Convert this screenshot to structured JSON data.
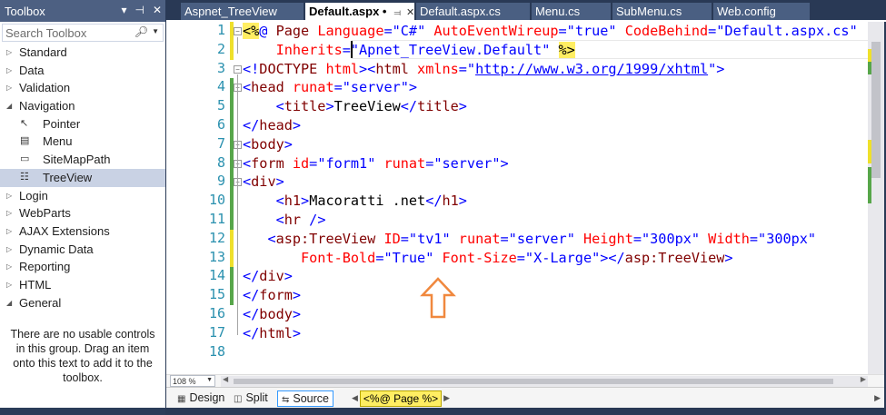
{
  "toolbox": {
    "title": "Toolbox",
    "dropdown_glyph": "▾",
    "pin_glyph": "⊣",
    "close_glyph": "✕",
    "search_placeholder": "Search Toolbox",
    "categories_before": [
      {
        "label": "Standard",
        "expanded": false
      },
      {
        "label": "Data",
        "expanded": false
      },
      {
        "label": "Validation",
        "expanded": false
      },
      {
        "label": "Navigation",
        "expanded": true
      }
    ],
    "navigation_items": [
      {
        "label": "Pointer",
        "icon": "pointer-icon",
        "glyph": "↖"
      },
      {
        "label": "Menu",
        "icon": "menu-icon",
        "glyph": "▤"
      },
      {
        "label": "SiteMapPath",
        "icon": "sitemap-icon",
        "glyph": "▭"
      },
      {
        "label": "TreeView",
        "icon": "treeview-icon",
        "glyph": "☷",
        "selected": true
      }
    ],
    "categories_after": [
      {
        "label": "Login",
        "expanded": false
      },
      {
        "label": "WebParts",
        "expanded": false
      },
      {
        "label": "AJAX Extensions",
        "expanded": false
      },
      {
        "label": "Dynamic Data",
        "expanded": false
      },
      {
        "label": "Reporting",
        "expanded": false
      },
      {
        "label": "HTML",
        "expanded": false
      },
      {
        "label": "General",
        "expanded": true
      }
    ],
    "empty_message": "There are no usable controls in this group. Drag an item onto this text to add it to the toolbox."
  },
  "tabs": [
    {
      "label": "Aspnet_TreeView",
      "active": false
    },
    {
      "label": "Default.aspx",
      "active": true,
      "modified_dot": "•"
    },
    {
      "label": "Default.aspx.cs",
      "active": false
    },
    {
      "label": "Menu.cs",
      "active": false
    },
    {
      "label": "SubMenu.cs",
      "active": false
    },
    {
      "label": "Web.config",
      "active": false
    }
  ],
  "editor": {
    "line_numbers": [
      "1",
      "2",
      "3",
      "4",
      "5",
      "6",
      "7",
      "8",
      "9",
      "10",
      "11",
      "12",
      "13",
      "14",
      "15",
      "16",
      "17",
      "18"
    ],
    "lines": [
      [
        [
          "dir",
          "<%"
        ],
        [
          "pu",
          "@ "
        ],
        [
          "tg",
          "Page "
        ],
        [
          "at",
          "Language"
        ],
        [
          "pu",
          "=\""
        ],
        [
          "vl",
          "C#"
        ],
        [
          "pu",
          "\" "
        ],
        [
          "at",
          "AutoEventWireup"
        ],
        [
          "pu",
          "=\""
        ],
        [
          "vl",
          "true"
        ],
        [
          "pu",
          "\" "
        ],
        [
          "at",
          "CodeBehind"
        ],
        [
          "pu",
          "=\""
        ],
        [
          "vl",
          "Default.aspx.cs"
        ],
        [
          "pu",
          "\""
        ]
      ],
      [
        [
          "tx",
          "    "
        ],
        [
          "at",
          "Inherits"
        ],
        [
          "pu",
          "=\""
        ],
        [
          "vl",
          "Apnet_TreeView.Default"
        ],
        [
          "pu",
          "\" "
        ],
        [
          "dir",
          "%>"
        ]
      ],
      [
        [
          "pu",
          "<!"
        ],
        [
          "tg",
          "DOCTYPE "
        ],
        [
          "at",
          "html"
        ],
        [
          "pu",
          "><"
        ],
        [
          "tg",
          "html "
        ],
        [
          "at",
          "xmlns"
        ],
        [
          "pu",
          "=\""
        ],
        [
          "url",
          "http://www.w3.org/1999/xhtml"
        ],
        [
          "pu",
          "\">"
        ]
      ],
      [
        [
          "pu",
          "<"
        ],
        [
          "tg",
          "head "
        ],
        [
          "at",
          "runat"
        ],
        [
          "pu",
          "=\""
        ],
        [
          "vl",
          "server"
        ],
        [
          "pu",
          "\">"
        ]
      ],
      [
        [
          "tx",
          "    "
        ],
        [
          "pu",
          "<"
        ],
        [
          "tg",
          "title"
        ],
        [
          "pu",
          ">"
        ],
        [
          "tx",
          "TreeView"
        ],
        [
          "pu",
          "</"
        ],
        [
          "tg",
          "title"
        ],
        [
          "pu",
          ">"
        ]
      ],
      [
        [
          "pu",
          "</"
        ],
        [
          "tg",
          "head"
        ],
        [
          "pu",
          ">"
        ]
      ],
      [
        [
          "pu",
          "<"
        ],
        [
          "tg",
          "body"
        ],
        [
          "pu",
          ">"
        ]
      ],
      [
        [
          "pu",
          "<"
        ],
        [
          "tg",
          "form "
        ],
        [
          "at",
          "id"
        ],
        [
          "pu",
          "=\""
        ],
        [
          "vl",
          "form1"
        ],
        [
          "pu",
          "\" "
        ],
        [
          "at",
          "runat"
        ],
        [
          "pu",
          "=\""
        ],
        [
          "vl",
          "server"
        ],
        [
          "pu",
          "\">"
        ]
      ],
      [
        [
          "pu",
          "<"
        ],
        [
          "tg",
          "div"
        ],
        [
          "pu",
          ">"
        ]
      ],
      [
        [
          "tx",
          "    "
        ],
        [
          "pu",
          "<"
        ],
        [
          "tg",
          "h1"
        ],
        [
          "pu",
          ">"
        ],
        [
          "tx",
          "Macoratti .net"
        ],
        [
          "pu",
          "</"
        ],
        [
          "tg",
          "h1"
        ],
        [
          "pu",
          ">"
        ]
      ],
      [
        [
          "tx",
          "    "
        ],
        [
          "pu",
          "<"
        ],
        [
          "tg",
          "hr "
        ],
        [
          "pu",
          "/>"
        ]
      ],
      [
        [
          "tx",
          "   "
        ],
        [
          "pu",
          "<"
        ],
        [
          "tg",
          "asp:TreeView "
        ],
        [
          "at",
          "ID"
        ],
        [
          "pu",
          "=\""
        ],
        [
          "vl",
          "tv1"
        ],
        [
          "pu",
          "\" "
        ],
        [
          "at",
          "runat"
        ],
        [
          "pu",
          "=\""
        ],
        [
          "vl",
          "server"
        ],
        [
          "pu",
          "\" "
        ],
        [
          "at",
          "Height"
        ],
        [
          "pu",
          "=\""
        ],
        [
          "vl",
          "300px"
        ],
        [
          "pu",
          "\" "
        ],
        [
          "at",
          "Width"
        ],
        [
          "pu",
          "=\""
        ],
        [
          "vl",
          "300px"
        ],
        [
          "pu",
          "\""
        ]
      ],
      [
        [
          "tx",
          "       "
        ],
        [
          "at",
          "Font-Bold"
        ],
        [
          "pu",
          "=\""
        ],
        [
          "vl",
          "True"
        ],
        [
          "pu",
          "\" "
        ],
        [
          "at",
          "Font-Size"
        ],
        [
          "pu",
          "=\""
        ],
        [
          "vl",
          "X-Large"
        ],
        [
          "pu",
          "\"></"
        ],
        [
          "tg",
          "asp:TreeView"
        ],
        [
          "pu",
          ">"
        ]
      ],
      [
        [
          "pu",
          "</"
        ],
        [
          "tg",
          "div"
        ],
        [
          "pu",
          ">"
        ]
      ],
      [
        [
          "pu",
          "</"
        ],
        [
          "tg",
          "form"
        ],
        [
          "pu",
          ">"
        ]
      ],
      [
        [
          "pu",
          "</"
        ],
        [
          "tg",
          "body"
        ],
        [
          "pu",
          ">"
        ]
      ],
      [
        [
          "pu",
          "</"
        ],
        [
          "tg",
          "html"
        ],
        [
          "pu",
          ">"
        ]
      ],
      []
    ]
  },
  "statusbar": {
    "zoom": "108 %",
    "design_label": "Design",
    "split_label": "Split",
    "source_label": "Source",
    "tag_navigator": "<%@ Page %>"
  },
  "colors": {
    "annotation_arrow": "#f0883e",
    "change_saved": "#57a64a",
    "change_unsaved": "#efe02b"
  }
}
